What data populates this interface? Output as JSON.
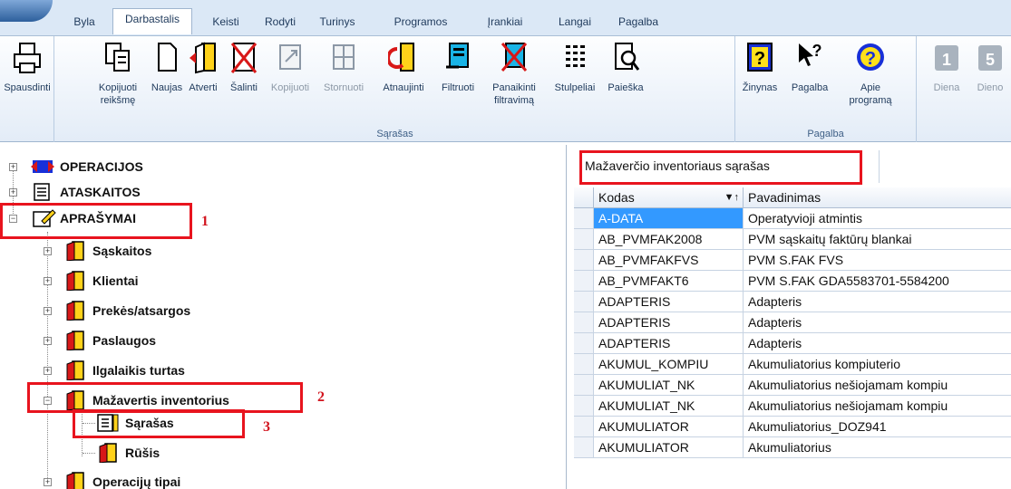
{
  "menu": {
    "tabs": [
      "Byla",
      "Darbastalis",
      "Keisti",
      "Rodyti",
      "Turinys",
      "Programos",
      "Įrankiai",
      "Langai",
      "Pagalba"
    ],
    "active": "Darbastalis"
  },
  "ribbon": {
    "print": "Spausdinti",
    "sarasas_group": "Sąrašas",
    "pagalba_group": "Pagalba",
    "buttons": {
      "copy_value": "Kopijuoti reikšmę",
      "new": "Naujas",
      "open": "Atverti",
      "delete": "Šalinti",
      "copy": "Kopijuoti",
      "cancel": "Stornuoti",
      "refresh": "Atnaujinti",
      "filter": "Filtruoti",
      "unfilter": "Panaikinti filtravimą",
      "columns": "Stulpeliai",
      "search": "Paieška",
      "help_book": "Žinynas",
      "help": "Pagalba",
      "about": "Apie programą",
      "day": "Diena",
      "days": "Dieno"
    },
    "day_nums": [
      "1",
      "5"
    ]
  },
  "tree": {
    "operacijos": "OPERACIJOS",
    "ataskaitos": "ATASKAITOS",
    "aprasymai": "APRAŠYMAI",
    "saskaitos": "Sąskaitos",
    "klientai": "Klientai",
    "prekes": "Prekės/atsargos",
    "paslaugos": "Paslaugos",
    "ilgalaikis": "Ilgalaikis turtas",
    "mazavertis": "Mažavertis inventorius",
    "sarasas": "Sąrašas",
    "rusis": "Rūšis",
    "operaciju_tipai": "Operacijų tipai",
    "markers": [
      "1",
      "2",
      "3"
    ]
  },
  "grid": {
    "title": "Mažaverčio inventoriaus sąrašas",
    "columns": [
      "Kodas",
      "Pavadinimas"
    ],
    "rows": [
      [
        "A-DATA",
        "Operatyvioji atmintis"
      ],
      [
        "AB_PVMFAK2008",
        "PVM  sąskaitų faktūrų blankai"
      ],
      [
        "AB_PVMFAKFVS",
        "PVM  S.FAK FVS"
      ],
      [
        "AB_PVMFAKT6",
        "PVM S.FAK GDA5583701-5584200"
      ],
      [
        "ADAPTERIS",
        "Adapteris"
      ],
      [
        "ADAPTERIS",
        "Adapteris"
      ],
      [
        "ADAPTERIS",
        "Adapteris"
      ],
      [
        "AKUMUL_KOMPIU",
        "Akumuliatorius kompiuterio"
      ],
      [
        "AKUMULIAT_NK",
        "Akumuliatorius nešiojamam kompiu"
      ],
      [
        "AKUMULIAT_NK",
        "Akumuliatorius nešiojamam kompiu"
      ],
      [
        "AKUMULIATOR",
        "Akumuliatorius_DOZ941"
      ],
      [
        "AKUMULIATOR",
        "Akumuliatorius"
      ]
    ]
  }
}
